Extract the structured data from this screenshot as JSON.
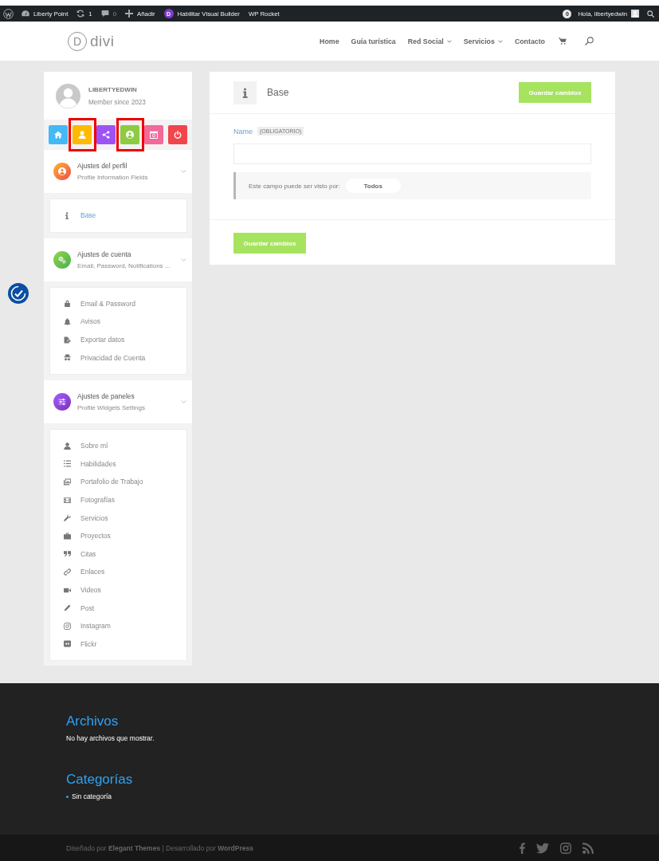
{
  "admin_bar": {
    "left": [
      {
        "kind": "site",
        "label": "Liberty Point"
      },
      {
        "kind": "updates",
        "label": "1"
      },
      {
        "kind": "comments",
        "label": "0"
      },
      {
        "kind": "new",
        "label": "Añadir"
      },
      {
        "kind": "builder",
        "badge": "D",
        "label": "Habilitar Visual Builder"
      },
      {
        "kind": "plain",
        "label": "WP Rocket"
      }
    ],
    "notification_count": "0",
    "greeting": "Hola, libertyedwin"
  },
  "header": {
    "logo": {
      "mark": "D",
      "text": "divi"
    },
    "nav": [
      {
        "label": "Home",
        "dropdown": false
      },
      {
        "label": "Guía turística",
        "dropdown": false
      },
      {
        "label": "Red Social",
        "dropdown": true
      },
      {
        "label": "Servicios",
        "dropdown": true
      },
      {
        "label": "Contacto",
        "dropdown": false
      }
    ]
  },
  "sidebar": {
    "profile": {
      "name": "LIBERTYEDWIN",
      "member_since": "Member since 2023"
    },
    "icon_buttons": [
      {
        "kind": "home",
        "color": "#43b9f6",
        "highlighted": false
      },
      {
        "kind": "person",
        "color": "#ffb900",
        "highlighted": true
      },
      {
        "kind": "share",
        "color": "#9d52f5",
        "highlighted": false
      },
      {
        "kind": "account",
        "color": "#8dcb42",
        "highlighted": true
      },
      {
        "kind": "calendar",
        "color": "#f2699a",
        "highlighted": false
      },
      {
        "kind": "power",
        "color": "#f2454b",
        "highlighted": false
      }
    ],
    "sections": [
      {
        "kind": "profile",
        "title": "Ajustes del perfil",
        "subtitle": "Profile Information Fields",
        "items": [
          {
            "kind": "info",
            "label": "Base",
            "selected": true
          }
        ]
      },
      {
        "kind": "account",
        "title": "Ajustes de cuenta",
        "subtitle": "Email, Password, Notifications ...",
        "items": [
          {
            "kind": "lock",
            "label": "Email & Password",
            "selected": false
          },
          {
            "kind": "bell",
            "label": "Avisos",
            "selected": false
          },
          {
            "kind": "export",
            "label": "Exportar datos",
            "selected": false
          },
          {
            "kind": "incognito",
            "label": "Privacidad de Cuenta",
            "selected": false
          }
        ]
      },
      {
        "kind": "widgets",
        "title": "Ajustes de paneles",
        "subtitle": "Profile Widgets Settings",
        "items": [
          {
            "kind": "person",
            "label": "Sobre mí",
            "selected": false
          },
          {
            "kind": "list",
            "label": "Habilidades",
            "selected": false
          },
          {
            "kind": "images",
            "label": "Portafolio de Trabajo",
            "selected": false
          },
          {
            "kind": "film",
            "label": "Fotografías",
            "selected": false
          },
          {
            "kind": "wrench",
            "label": "Servicios",
            "selected": false
          },
          {
            "kind": "briefcase",
            "label": "Proyectos",
            "selected": false
          },
          {
            "kind": "quote",
            "label": "Citas",
            "selected": false
          },
          {
            "kind": "link",
            "label": "Enlaces",
            "selected": false
          },
          {
            "kind": "video",
            "label": "Videos",
            "selected": false
          },
          {
            "kind": "pencil",
            "label": "Post",
            "selected": false
          },
          {
            "kind": "camera",
            "label": "Instagram",
            "selected": false
          },
          {
            "kind": "dots",
            "label": "Flickr",
            "selected": false
          }
        ]
      }
    ]
  },
  "panel": {
    "title": "Base",
    "save_button": "Guardar cambios",
    "field": {
      "label": "Name",
      "required_tag": "(OBLIGATORIO)"
    },
    "visibility": {
      "label": "Este campo puede ser visto por:",
      "value": "Todos"
    },
    "footer_button": "Guardar cambios"
  },
  "footer": {
    "widgets": [
      {
        "kind": "text",
        "title": "Archivos",
        "text": "No hay archivos que mostrar."
      },
      {
        "kind": "list",
        "title": "Categorías",
        "items": [
          "Sin categoría"
        ]
      }
    ],
    "credits": "Diseñado por **Elegant Themes** | Desarrollado por **WordPress**"
  }
}
